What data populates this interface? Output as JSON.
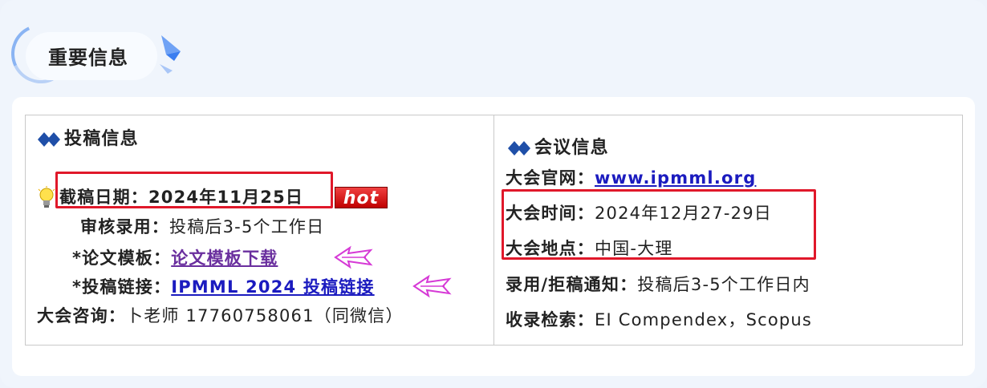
{
  "header": {
    "title": "重要信息"
  },
  "left": {
    "section_title": "投稿信息",
    "deadline_label": "截稿日期：",
    "deadline_value": "2024年11月25日",
    "hot_badge": "hot",
    "review_label": "审核录用：",
    "review_value": "投稿后3-5个工作日",
    "template_label": "*论文模板：",
    "template_link": "论文模板下载",
    "submit_label": "*投稿链接：",
    "submit_link": "IPMML 2024 投稿链接",
    "consult_label": "大会咨询：",
    "consult_value": "卜老师 17760758061（同微信）"
  },
  "right": {
    "section_title": "会议信息",
    "site_label": "大会官网：",
    "site_link": "www.ipmml.org",
    "time_label": "大会时间：",
    "time_value": "2024年12月27-29日",
    "place_label": "大会地点：",
    "place_value": "中国-大理",
    "notice_label": "录用/拒稿通知：",
    "notice_value": "投稿后3-5个工作日内",
    "index_label": "收录检索：",
    "index_value": "EI Compendex，Scopus"
  },
  "colors": {
    "link": "#1b1bbf",
    "visited_link": "#6a2f9e",
    "highlight_box": "#e0182a",
    "accent": "#1f4fa8"
  }
}
